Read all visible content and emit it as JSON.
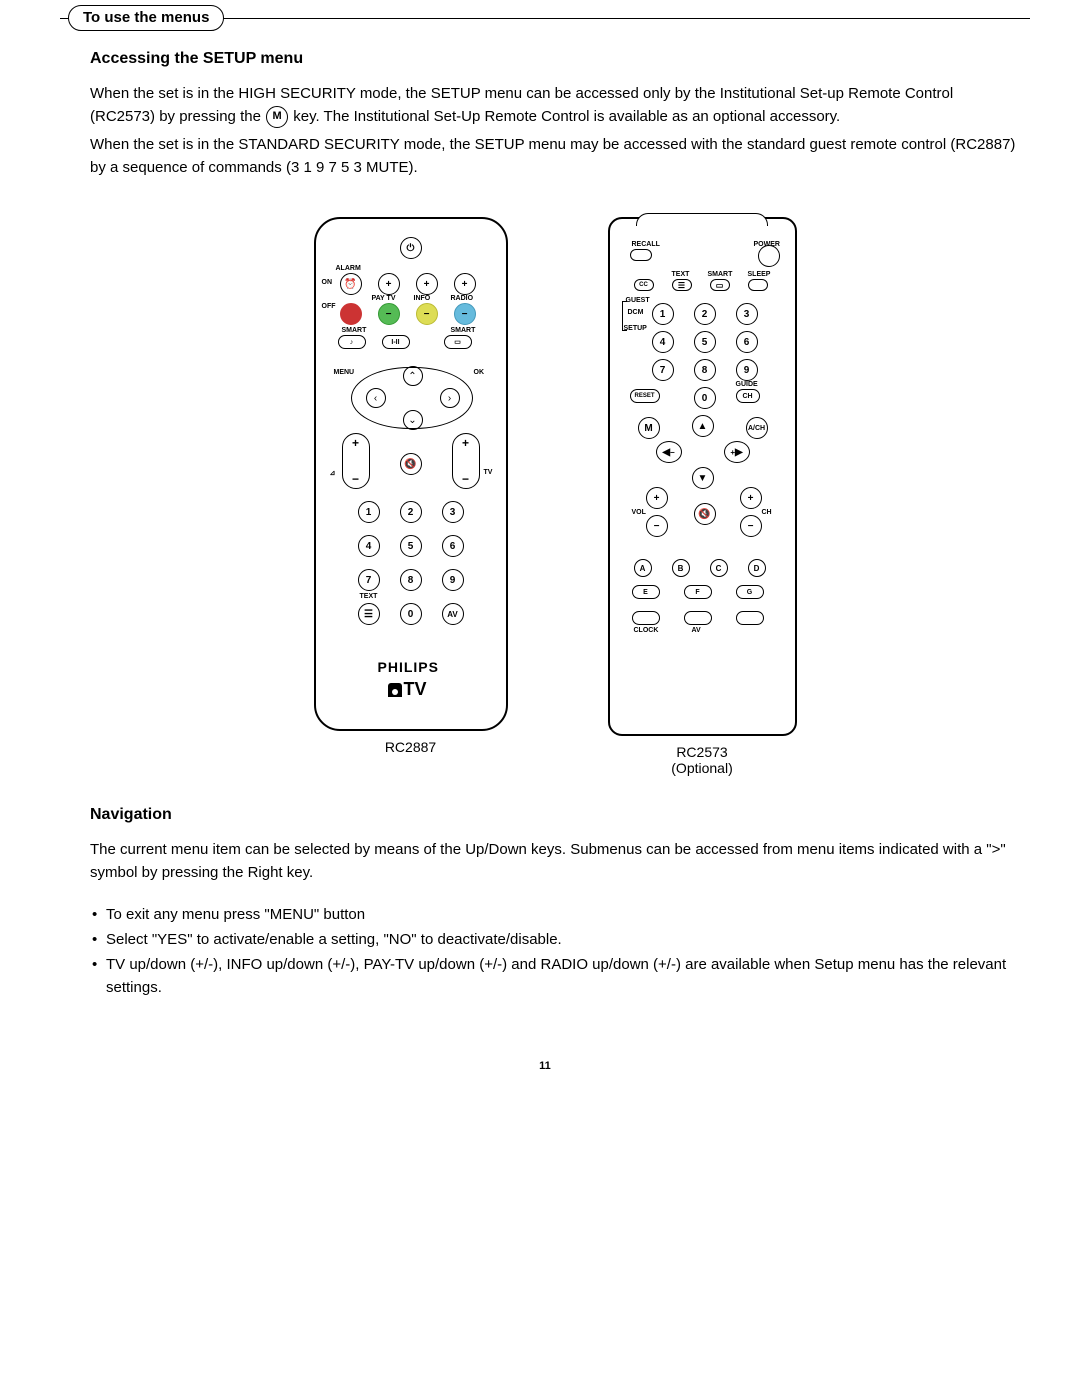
{
  "section_tab": "To use the menus",
  "accessing": {
    "heading": "Accessing the SETUP menu",
    "p1a": "When the set is in the HIGH SECURITY mode, the SETUP menu can be accessed only by the Institutional Set-up Remote Control (RC2573) by pressing the ",
    "key": "M",
    "p1b": " key. The Institutional Set-Up Remote Control is available as an optional accessory.",
    "p2": "When the set is in the STANDARD SECURITY mode, the SETUP menu may be accessed with the standard guest remote control (RC2887) by a sequence of commands (3 1 9 7 5 3 MUTE)."
  },
  "remote1": {
    "caption": "RC2887",
    "brand": "PHILIPS",
    "tv": "TV",
    "labels": {
      "alarm": "ALARM",
      "on": "ON",
      "off": "OFF",
      "paytv": "PAY TV",
      "info": "INFO",
      "radio": "RADIO",
      "smart1": "SMART",
      "smart2": "SMART",
      "menu": "MENU",
      "ok": "OK",
      "tv": "TV",
      "text": "TEXT"
    },
    "keys": {
      "n1": "1",
      "n2": "2",
      "n3": "3",
      "n4": "4",
      "n5": "5",
      "n6": "6",
      "n7": "7",
      "n8": "8",
      "n9": "9",
      "n0": "0",
      "av": "AV",
      "note": "♪",
      "dual": "I-II",
      "fmt": "▭",
      "plus": "+",
      "minus": "−",
      "mute": "🔇",
      "power": "⏻"
    }
  },
  "remote2": {
    "caption1": "RC2573",
    "caption2": "(Optional)",
    "labels": {
      "recall": "RECALL",
      "power": "POWER",
      "text": "TEXT",
      "smart": "SMART",
      "sleep": "SLEEP",
      "guest": "GUEST",
      "dcm": "DCM",
      "setup": "SETUP",
      "guide": "GUIDE",
      "vol": "VOL",
      "ch": "CH",
      "clock": "CLOCK",
      "av": "AV"
    },
    "keys": {
      "cc": "CC",
      "fmt": "▭",
      "sleep": "",
      "n1": "1",
      "n2": "2",
      "n3": "3",
      "n4": "4",
      "n5": "5",
      "n6": "6",
      "n7": "7",
      "n8": "8",
      "n9": "9",
      "n0": "0",
      "reset": "RESET",
      "chg": "CH",
      "m": "M",
      "ach": "A/CH",
      "a": "A",
      "b": "B",
      "c": "C",
      "d": "D",
      "e": "E",
      "f": "F",
      "g": "G",
      "plus": "+",
      "minus": "−",
      "mute": "🔇",
      "up": "▲",
      "down": "▼",
      "left": "◀",
      "right": "▶"
    }
  },
  "navigation": {
    "heading": "Navigation",
    "p1": "The current menu item can be selected by means of the Up/Down keys. Submenus can be accessed from menu items indicated with a \">\" symbol by pressing the Right key.",
    "b1": "To exit any menu press \"MENU\" button",
    "b2": "Select \"YES\" to activate/enable a setting, \"NO\" to deactivate/disable.",
    "b3": "TV up/down (+/-), INFO up/down (+/-), PAY-TV up/down (+/-) and RADIO up/down (+/-) are available when Setup menu has the relevant settings."
  },
  "page_number": "11"
}
